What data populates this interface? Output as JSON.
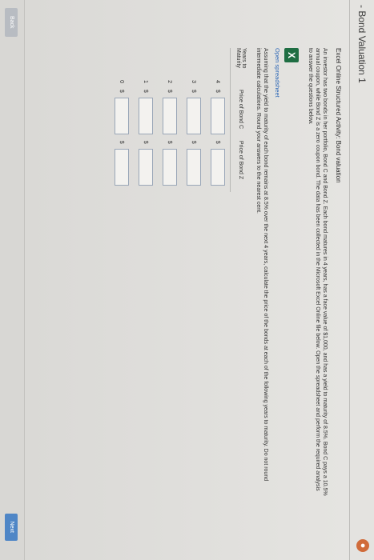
{
  "header": {
    "title": "- Bond Valuation 1",
    "help_icon": "orange-circle-icon"
  },
  "activity": {
    "title": "Excel Online Structured Activity: Bond valuation",
    "description": "An investor has two bonds in her portfolio, Bond C and Bond Z. Each bond matures in 4 years, has a face value of $1,000, and has a yield to maturity of 8.5%. Bond C pays a 10.5% annual coupon, while Bond Z is a zero coupon bond. The data has been collected in the Microsoft Excel Online file below. Open the spreadsheet and perform the required analysis to answer the questions below.",
    "excel_icon": "excel-icon",
    "open_link": "Open spreadsheet",
    "instructions": "Assuming that the yield to maturity of each bond remains at 8.5% over the next 4 years, calculate the price of the bonds at each of the following years to maturity. Do not round intermediate calculations. Round your answers to the nearest cent."
  },
  "table": {
    "headers": [
      "Years to Maturity",
      "Price of Bond C",
      "Price of Bond Z"
    ],
    "currency_symbol": "$",
    "rows": [
      {
        "years": "4",
        "bond_c": "",
        "bond_z": ""
      },
      {
        "years": "3",
        "bond_c": "",
        "bond_z": ""
      },
      {
        "years": "2",
        "bond_c": "",
        "bond_z": ""
      },
      {
        "years": "1",
        "bond_c": "",
        "bond_z": ""
      },
      {
        "years": "0",
        "bond_c": "",
        "bond_z": ""
      }
    ]
  },
  "footer": {
    "back_label": "Back",
    "next_label": "Next"
  }
}
